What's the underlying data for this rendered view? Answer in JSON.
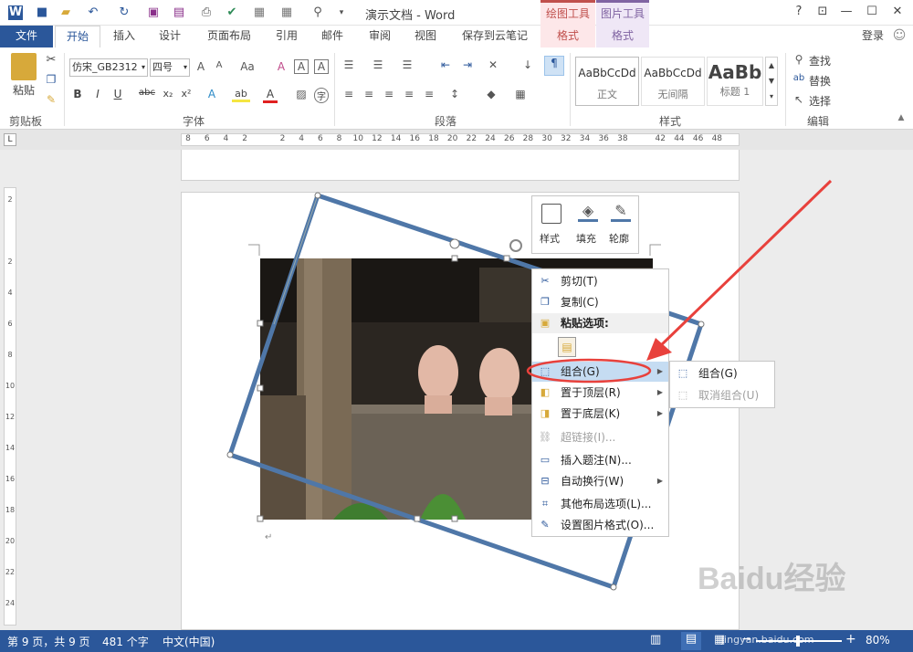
{
  "title_bar": {
    "title": "演示文档 - Word",
    "context_tools": [
      "绘图工具",
      "图片工具"
    ],
    "help_label": "?"
  },
  "tabs": [
    "文件",
    "开始",
    "插入",
    "设计",
    "页面布局",
    "引用",
    "邮件",
    "审阅",
    "视图",
    "保存到云笔记",
    "格式",
    "格式"
  ],
  "login_label": "登录",
  "ribbon": {
    "clipboard": {
      "paste_label": "粘贴",
      "group_label": "剪贴板"
    },
    "font": {
      "font_name": "仿宋_GB2312",
      "font_size": "四号",
      "group_label": "字体",
      "bold": "B",
      "italic": "I",
      "underline": "U",
      "strike": "abc",
      "sub": "x₂",
      "sup": "x²",
      "grow": "A",
      "shrink": "A",
      "case": "Aa",
      "clear": "A",
      "char_border": "A",
      "effect": "A",
      "highlight": "ab",
      "color": "A",
      "phonetic": "A",
      "enclose": "字"
    },
    "paragraph": {
      "group_label": "段落"
    },
    "styles": {
      "items": [
        {
          "preview": "AaBbCcDd",
          "name": "正文"
        },
        {
          "preview": "AaBbCcDd",
          "name": "无间隔"
        },
        {
          "preview": "AaBb",
          "name": "标题 1"
        }
      ],
      "group_label": "样式"
    },
    "editing": {
      "find": "查找",
      "replace": "替换",
      "select": "选择",
      "group_label": "编辑"
    }
  },
  "ruler": {
    "ticks": [
      "8",
      "6",
      "4",
      "2",
      "",
      "2",
      "4",
      "6",
      "8",
      "10",
      "12",
      "14",
      "16",
      "18",
      "20",
      "22",
      "24",
      "26",
      "28",
      "30",
      "32",
      "34",
      "36",
      "38",
      "",
      "42",
      "44",
      "46",
      "48"
    ]
  },
  "vruler": {
    "ticks": [
      "2",
      "",
      "2",
      "4",
      "6",
      "8",
      "10",
      "12",
      "14",
      "16",
      "18",
      "20",
      "22",
      "24"
    ]
  },
  "mini_toolbar": {
    "items": [
      "样式",
      "填充",
      "轮廓"
    ]
  },
  "context_menu": {
    "items": [
      {
        "label": "剪切(T)",
        "icon": "scissors-icon"
      },
      {
        "label": "复制(C)",
        "icon": "copy-icon"
      },
      {
        "label": "粘贴选项:",
        "icon": "paste-icon"
      },
      {
        "label": "组合(G)",
        "icon": "group-icon"
      },
      {
        "label": "置于顶层(R)",
        "icon": "bring-front-icon"
      },
      {
        "label": "置于底层(K)",
        "icon": "send-back-icon"
      },
      {
        "label": "超链接(I)...",
        "icon": "hyperlink-icon"
      },
      {
        "label": "插入题注(N)...",
        "icon": "caption-icon"
      },
      {
        "label": "自动换行(W)",
        "icon": "wrap-icon"
      },
      {
        "label": "其他布局选项(L)...",
        "icon": "layout-icon"
      },
      {
        "label": "设置图片格式(O)...",
        "icon": "format-picture-icon"
      }
    ]
  },
  "submenu": {
    "items": [
      "组合(G)",
      "取消组合(U)"
    ]
  },
  "status": {
    "page": "第 9 页，共 9 页",
    "words": "481 个字",
    "lang": "中文(中国)",
    "zoom": "80%"
  },
  "watermark": {
    "brand": "Baidu经验",
    "url": "jingyan.baidu.com"
  },
  "colors": {
    "accent": "#2b579a",
    "drawing_tools": "#c0504d",
    "picture_tools": "#8064a2",
    "highlight_oval": "#e8413c"
  }
}
